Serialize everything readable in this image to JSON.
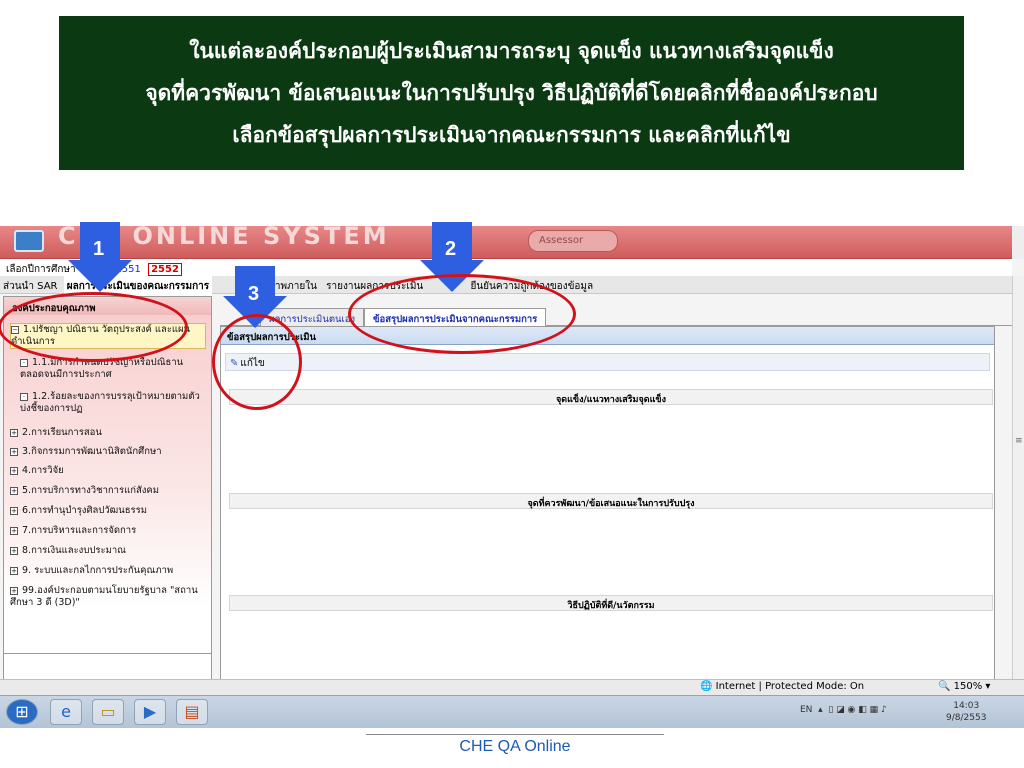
{
  "banner": {
    "line1": "ในแต่ละองค์ประกอบผู้ประเมินสามารถระบุ จุดแข็ง แนวทางเสริมจุดแข็ง",
    "line2": "จุดที่ควรพัฒนา ข้อเสนอแนะในการปรับปรุง วิธีปฏิบัติที่ดีโดยคลิกที่ชื่อองค์ประกอบ",
    "line3": "เลือกข้อสรุปผลการประเมินจากคณะกรรมการ และคลิกที่แก้ไข"
  },
  "app": {
    "title": "CHE  ONLINE  SYSTEM",
    "assessor_label": "Assessor"
  },
  "yearbar": {
    "label": "เลือกปีการศึกษา",
    "years": [
      "2550",
      "2551"
    ],
    "selected_year": "2552"
  },
  "tabs": [
    "ส่วนนำ SAR",
    "ผลการประเมินของคณะกรรมการ",
    "คุณภาพภายใน",
    "รายงานผลการประเมิน",
    "ยืนยันความถูกต้องของข้อมูล"
  ],
  "sidebar": {
    "header": "องค์ประกอบคุณภาพ",
    "items": [
      "1.ปรัชญา ปณิธาน วัตถุประสงค์ และแผนดำเนินการ",
      "1.1.มีการกำหนดปรัชญาหรือปณิธาน ตลอดจนมีการประกาศ",
      "1.2.ร้อยละของการบรรลุเป้าหมายตามตัวบ่งชี้ของการปฏ",
      "2.การเรียนการสอน",
      "3.กิจกรรมการพัฒนานิสิตนักศึกษา",
      "4.การวิจัย",
      "5.การบริการทางวิชาการแก่สังคม",
      "6.การทำนุบำรุงศิลปวัฒนธรรม",
      "7.การบริหารและการจัดการ",
      "8.การเงินและงบประมาณ",
      "9. ระบบและกลไกการประกันคุณภาพ",
      "99.องค์ประกอบตามนโยบายรัฐบาล \"สถานศึกษา 3 ดี (3D)\""
    ]
  },
  "subtabs": {
    "self": "ผลการประเมินตนเอง",
    "committee": "ข้อสรุปผลการประเมินจากคณะกรรมการ"
  },
  "panel": {
    "header": "ข้อสรุปผลการประเมิน",
    "edit_label": "แก้ไข",
    "sections": [
      "จุดแข็ง/แนวทางเสริมจุดแข็ง",
      "จุดที่ควรพัฒนา/ข้อเสนอแนะในการปรับปรุง",
      "วิธีปฏิบัติที่ดี/นวัตกรรม"
    ]
  },
  "statusbar": {
    "zone": "Internet | Protected Mode: On",
    "zoom": "150%"
  },
  "taskbar": {
    "lang": "EN",
    "time": "14:03",
    "date": "9/8/2553"
  },
  "callouts": [
    "1",
    "2",
    "3"
  ],
  "footer": "CHE QA Online",
  "colors": {
    "banner_bg": "#0b3a12",
    "callout_arrow": "#2e5fe0",
    "callout_ring": "#d1121a",
    "app_header": "#cf5c5c"
  }
}
